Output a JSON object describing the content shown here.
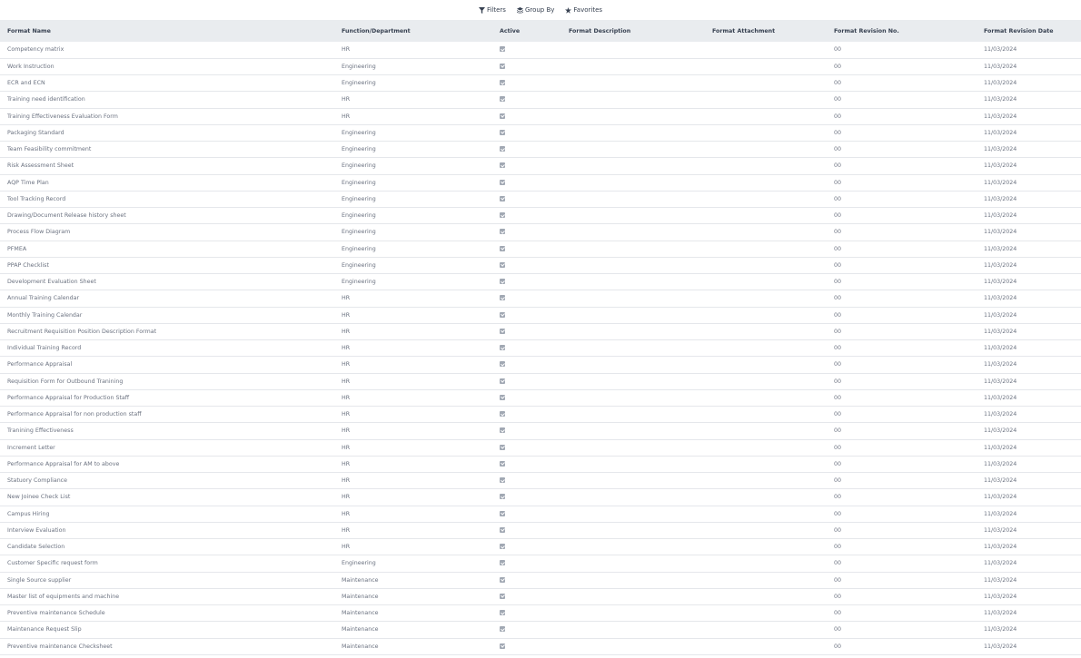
{
  "toolbar": {
    "filters_label": "Filters",
    "group_by_label": "Group By",
    "favorites_label": "Favorites"
  },
  "table": {
    "columns": [
      "Format Name",
      "Function/Department",
      "Active",
      "Format Description",
      "Format Attachment",
      "Format Revision No.",
      "Format Revision Date"
    ],
    "rows": [
      {
        "name": "Competency matrix",
        "dept": "HR",
        "active": true,
        "description": "",
        "attachment": "",
        "rev": "00",
        "date": "11/03/2024"
      },
      {
        "name": "Work Instruction",
        "dept": "Engineering",
        "active": true,
        "description": "",
        "attachment": "",
        "rev": "00",
        "date": "11/03/2024"
      },
      {
        "name": "ECR and ECN",
        "dept": "Engineering",
        "active": true,
        "description": "",
        "attachment": "",
        "rev": "00",
        "date": "11/03/2024"
      },
      {
        "name": "Training need identification",
        "dept": "HR",
        "active": true,
        "description": "",
        "attachment": "",
        "rev": "00",
        "date": "11/03/2024"
      },
      {
        "name": "Training Effectiveness Evaluation Form",
        "dept": "HR",
        "active": true,
        "description": "",
        "attachment": "",
        "rev": "00",
        "date": "11/03/2024"
      },
      {
        "name": "Packaging Standard",
        "dept": "Engineering",
        "active": true,
        "description": "",
        "attachment": "",
        "rev": "00",
        "date": "11/03/2024"
      },
      {
        "name": "Team Feasibility commitment",
        "dept": "Engineering",
        "active": true,
        "description": "",
        "attachment": "",
        "rev": "00",
        "date": "11/03/2024"
      },
      {
        "name": "Risk Assessment Sheet",
        "dept": "Engineering",
        "active": true,
        "description": "",
        "attachment": "",
        "rev": "00",
        "date": "11/03/2024"
      },
      {
        "name": "AQP Time Plan",
        "dept": "Engineering",
        "active": true,
        "description": "",
        "attachment": "",
        "rev": "00",
        "date": "11/03/2024"
      },
      {
        "name": "Tool Tracking Record",
        "dept": "Engineering",
        "active": true,
        "description": "",
        "attachment": "",
        "rev": "00",
        "date": "11/03/2024"
      },
      {
        "name": "Drawing/Document Release history sheet",
        "dept": "Engineering",
        "active": true,
        "description": "",
        "attachment": "",
        "rev": "00",
        "date": "11/03/2024"
      },
      {
        "name": "Process Flow Diagram",
        "dept": "Engineering",
        "active": true,
        "description": "",
        "attachment": "",
        "rev": "00",
        "date": "11/03/2024"
      },
      {
        "name": "PFMEA",
        "dept": "Engineering",
        "active": true,
        "description": "",
        "attachment": "",
        "rev": "00",
        "date": "11/03/2024"
      },
      {
        "name": "PPAP Checklist",
        "dept": "Engineering",
        "active": true,
        "description": "",
        "attachment": "",
        "rev": "00",
        "date": "11/03/2024"
      },
      {
        "name": "Development Evaluation Sheet",
        "dept": "Engineering",
        "active": true,
        "description": "",
        "attachment": "",
        "rev": "00",
        "date": "11/03/2024"
      },
      {
        "name": "Annual Training Calendar",
        "dept": "HR",
        "active": true,
        "description": "",
        "attachment": "",
        "rev": "00",
        "date": "11/03/2024"
      },
      {
        "name": "Monthly Training Calendar",
        "dept": "HR",
        "active": true,
        "description": "",
        "attachment": "",
        "rev": "00",
        "date": "11/03/2024"
      },
      {
        "name": "Recruitment Requisition Position Description Format",
        "dept": "HR",
        "active": true,
        "description": "",
        "attachment": "",
        "rev": "00",
        "date": "11/03/2024"
      },
      {
        "name": "Individual Training Record",
        "dept": "HR",
        "active": true,
        "description": "",
        "attachment": "",
        "rev": "00",
        "date": "11/03/2024"
      },
      {
        "name": "Performance Appraisal",
        "dept": "HR",
        "active": true,
        "description": "",
        "attachment": "",
        "rev": "00",
        "date": "11/03/2024"
      },
      {
        "name": "Requisition Form for Outbound Tranining",
        "dept": "HR",
        "active": true,
        "description": "",
        "attachment": "",
        "rev": "00",
        "date": "11/03/2024"
      },
      {
        "name": "Performance Appraisal for Production Staff",
        "dept": "HR",
        "active": true,
        "description": "",
        "attachment": "",
        "rev": "00",
        "date": "11/03/2024"
      },
      {
        "name": "Performance Appraisal for non production staff",
        "dept": "HR",
        "active": true,
        "description": "",
        "attachment": "",
        "rev": "00",
        "date": "11/03/2024"
      },
      {
        "name": "Tranining Effectiveness",
        "dept": "HR",
        "active": true,
        "description": "",
        "attachment": "",
        "rev": "00",
        "date": "11/03/2024"
      },
      {
        "name": "Increment Letter",
        "dept": "HR",
        "active": true,
        "description": "",
        "attachment": "",
        "rev": "00",
        "date": "11/03/2024"
      },
      {
        "name": "Performance Appraisal for AM to above",
        "dept": "HR",
        "active": true,
        "description": "",
        "attachment": "",
        "rev": "00",
        "date": "11/03/2024"
      },
      {
        "name": "Statuory Compliance",
        "dept": "HR",
        "active": true,
        "description": "",
        "attachment": "",
        "rev": "00",
        "date": "11/03/2024"
      },
      {
        "name": "New Joinee Check List",
        "dept": "HR",
        "active": true,
        "description": "",
        "attachment": "",
        "rev": "00",
        "date": "11/03/2024"
      },
      {
        "name": "Campus Hiring",
        "dept": "HR",
        "active": true,
        "description": "",
        "attachment": "",
        "rev": "00",
        "date": "11/03/2024"
      },
      {
        "name": "Interview Evaluation",
        "dept": "HR",
        "active": true,
        "description": "",
        "attachment": "",
        "rev": "00",
        "date": "11/03/2024"
      },
      {
        "name": "Candidate Selection",
        "dept": "HR",
        "active": true,
        "description": "",
        "attachment": "",
        "rev": "00",
        "date": "11/03/2024"
      },
      {
        "name": "Customer Specific request form",
        "dept": "Engineering",
        "active": true,
        "description": "",
        "attachment": "",
        "rev": "00",
        "date": "11/03/2024"
      },
      {
        "name": "Single Source supplier",
        "dept": "Maintenance",
        "active": true,
        "description": "",
        "attachment": "",
        "rev": "00",
        "date": "11/03/2024"
      },
      {
        "name": "Master list of equipments and machine",
        "dept": "Maintenance",
        "active": true,
        "description": "",
        "attachment": "",
        "rev": "00",
        "date": "11/03/2024"
      },
      {
        "name": "Preventive maintenance Schedule",
        "dept": "Maintenance",
        "active": true,
        "description": "",
        "attachment": "",
        "rev": "00",
        "date": "11/03/2024"
      },
      {
        "name": "Maintenance Request Slip",
        "dept": "Maintenance",
        "active": true,
        "description": "",
        "attachment": "",
        "rev": "00",
        "date": "11/03/2024"
      },
      {
        "name": "Preventive maintenance Checksheet",
        "dept": "Maintenance",
        "active": true,
        "description": "",
        "attachment": "",
        "rev": "00",
        "date": "11/03/2024"
      }
    ]
  }
}
